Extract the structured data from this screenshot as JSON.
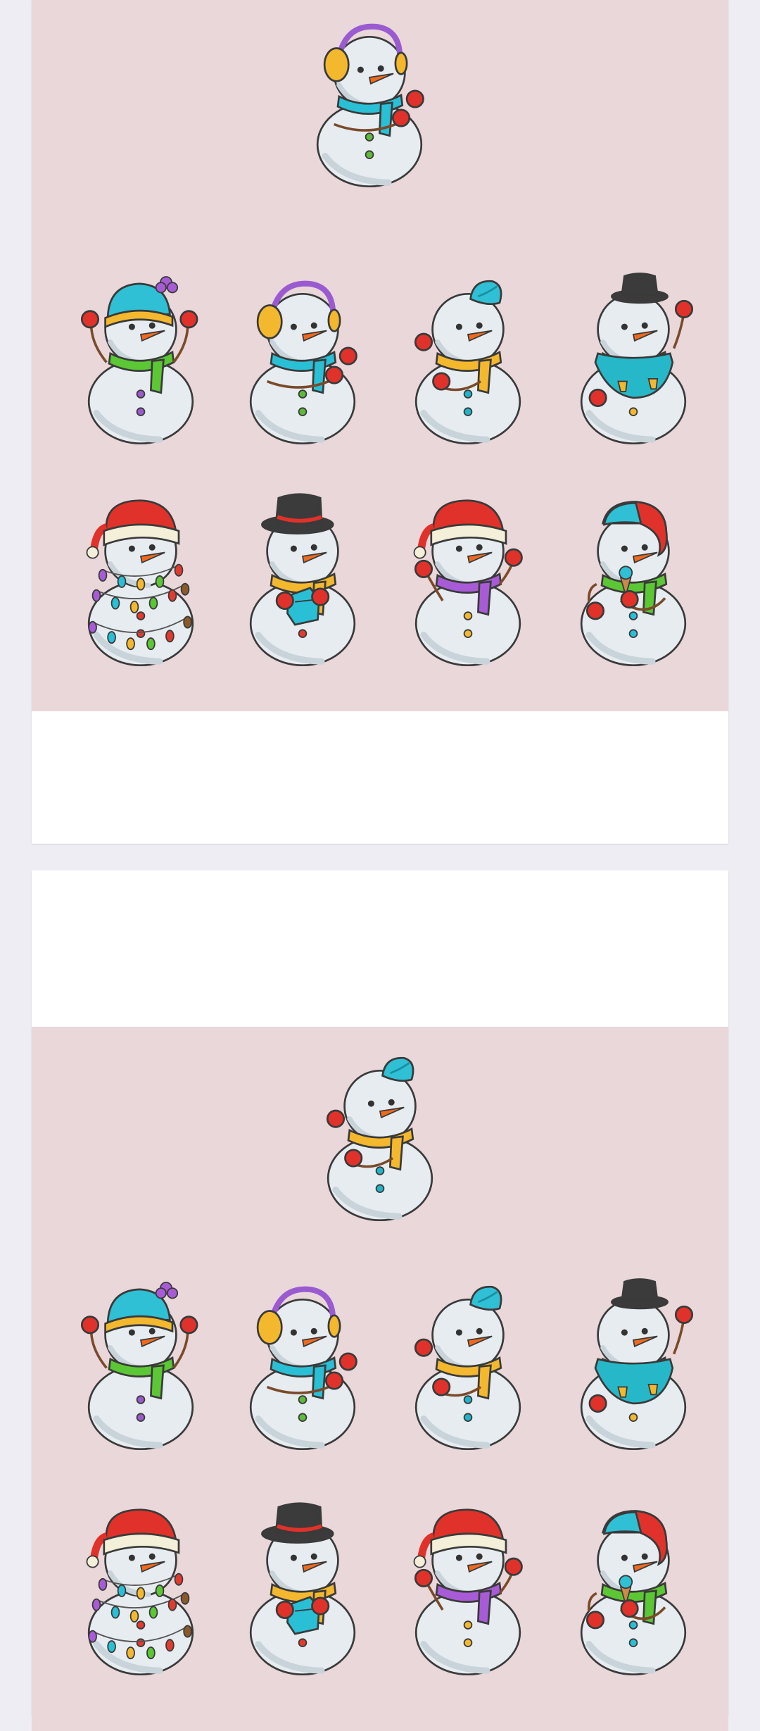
{
  "puzzles": [
    {
      "target": {
        "hat": "earmuffs",
        "scarf": "#29c0d6",
        "accent": "#7a4a2a",
        "button": "#5dbb3a",
        "arms": "cup"
      },
      "options": [
        {
          "hat": "beanie",
          "scarf": "#5cc734",
          "accent": "#b560d1",
          "button": "#9b59c9",
          "arms": "up"
        },
        {
          "hat": "earmuffs",
          "scarf": "#29c0d6",
          "accent": "#7a4a2a",
          "button": "#5dbb3a",
          "arms": "cup"
        },
        {
          "hat": "cap",
          "scarf": "#f4b82e",
          "accent": "#1fb5c9",
          "button": "#1fb5c9",
          "arms": "left"
        },
        {
          "hat": "tophat",
          "scarf": "#a85bd6",
          "accent": "#26b8c8",
          "button": "#f4b82e",
          "arms": "jacket"
        },
        {
          "hat": "santa",
          "scarf": "none",
          "accent": "#8b5a2b",
          "button": "#e23b2e",
          "arms": "lights"
        },
        {
          "hat": "tophat2",
          "scarf": "#f4b82e",
          "accent": "#29c0d6",
          "button": "#e23b2e",
          "arms": "gift"
        },
        {
          "hat": "santa",
          "scarf": "#a85bd6",
          "accent": "#f4b82e",
          "button": "#f4b82e",
          "arms": "wave"
        },
        {
          "hat": "capred",
          "scarf": "#5cc734",
          "accent": "#29c0d6",
          "button": "#29c0d6",
          "arms": "icecream"
        }
      ]
    },
    {
      "target": {
        "hat": "cap",
        "scarf": "#f4b82e",
        "accent": "#1fb5c9",
        "button": "#1fb5c9",
        "arms": "left"
      },
      "options": [
        {
          "hat": "beanie",
          "scarf": "#5cc734",
          "accent": "#b560d1",
          "button": "#9b59c9",
          "arms": "up"
        },
        {
          "hat": "earmuffs",
          "scarf": "#29c0d6",
          "accent": "#7a4a2a",
          "button": "#5dbb3a",
          "arms": "cup"
        },
        {
          "hat": "cap",
          "scarf": "#f4b82e",
          "accent": "#1fb5c9",
          "button": "#1fb5c9",
          "arms": "left"
        },
        {
          "hat": "tophat",
          "scarf": "#a85bd6",
          "accent": "#26b8c8",
          "button": "#f4b82e",
          "arms": "jacket"
        },
        {
          "hat": "santa",
          "scarf": "none",
          "accent": "#8b5a2b",
          "button": "#e23b2e",
          "arms": "lights"
        },
        {
          "hat": "tophat2",
          "scarf": "#f4b82e",
          "accent": "#29c0d6",
          "button": "#e23b2e",
          "arms": "gift"
        },
        {
          "hat": "santa",
          "scarf": "#a85bd6",
          "accent": "#f4b82e",
          "button": "#f4b82e",
          "arms": "wave"
        },
        {
          "hat": "capred",
          "scarf": "#5cc734",
          "accent": "#29c0d6",
          "button": "#29c0d6",
          "arms": "icecream"
        }
      ]
    }
  ]
}
